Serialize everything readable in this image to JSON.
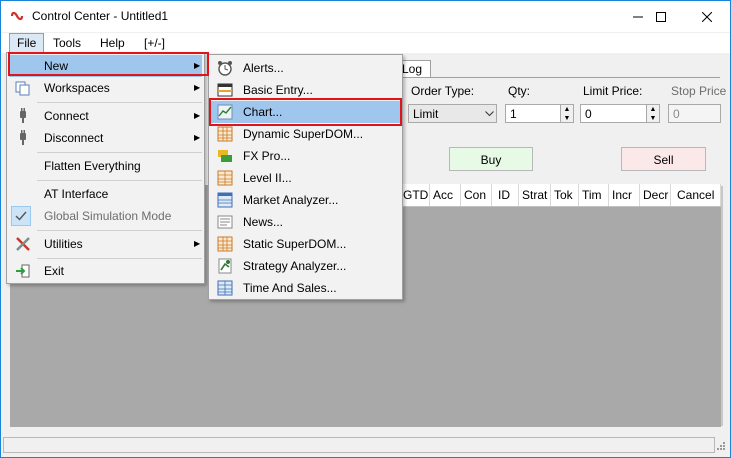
{
  "window": {
    "title": "Control Center - Untitled1",
    "controls": {
      "minimize": "–",
      "maximize": "☐",
      "close": "✕"
    }
  },
  "menubar": [
    "File",
    "Tools",
    "Help",
    "[+/-]"
  ],
  "file_menu": {
    "items": [
      {
        "label": "New",
        "icon": "none",
        "has_submenu": true,
        "highlighted": true
      },
      {
        "label": "Workspaces",
        "icon": "workspaces-icon",
        "has_submenu": true
      },
      {
        "label": "Connect",
        "icon": "connect-plug-icon",
        "has_submenu": true
      },
      {
        "label": "Disconnect",
        "icon": "disconnect-plug-icon",
        "has_submenu": true
      },
      {
        "label": "Flatten Everything",
        "icon": "none"
      },
      {
        "label": "AT Interface",
        "icon": "none"
      },
      {
        "label": "Global Simulation Mode",
        "icon": "checkmark-icon",
        "checked": true,
        "disabled": true
      },
      {
        "label": "Utilities",
        "icon": "utilities-tools-icon",
        "has_submenu": true
      },
      {
        "label": "Exit",
        "icon": "exit-icon"
      }
    ]
  },
  "new_submenu": {
    "items": [
      {
        "label": "Alerts...",
        "icon": "alarm-clock-icon"
      },
      {
        "label": "Basic Entry...",
        "icon": "basic-entry-icon"
      },
      {
        "label": "Chart...",
        "icon": "chart-icon",
        "highlighted": true
      },
      {
        "label": "Dynamic SuperDOM...",
        "icon": "superdom-grid-icon"
      },
      {
        "label": "FX Pro...",
        "icon": "fx-pro-icon"
      },
      {
        "label": "Level II...",
        "icon": "level-ii-icon"
      },
      {
        "label": "Market Analyzer...",
        "icon": "market-analyzer-icon"
      },
      {
        "label": "News...",
        "icon": "news-icon"
      },
      {
        "label": "Static SuperDOM...",
        "icon": "static-superdom-icon"
      },
      {
        "label": "Strategy Analyzer...",
        "icon": "strategy-analyzer-icon"
      },
      {
        "label": "Time And Sales...",
        "icon": "time-and-sales-icon"
      }
    ]
  },
  "tabs": {
    "log": "Log"
  },
  "order_panel": {
    "order_type_label": "Order Type:",
    "order_type_value": "Limit",
    "qty_label": "Qty:",
    "qty_value": "1",
    "limit_price_label": "Limit Price:",
    "limit_price_value": "0",
    "stop_price_label": "Stop Price",
    "stop_price_value": "0",
    "buy_label": "Buy",
    "sell_label": "Sell"
  },
  "grid_columns": [
    "GTD",
    "Acc",
    "Con",
    "ID",
    "Strat",
    "Tok",
    "Tim",
    "Incr",
    "Decr",
    "Cancel"
  ],
  "colors": {
    "highlight": "#9fc6ec",
    "annotation_red": "#e0151b",
    "buy_bg": "#e6fae6",
    "sell_bg": "#fbe8e8"
  }
}
